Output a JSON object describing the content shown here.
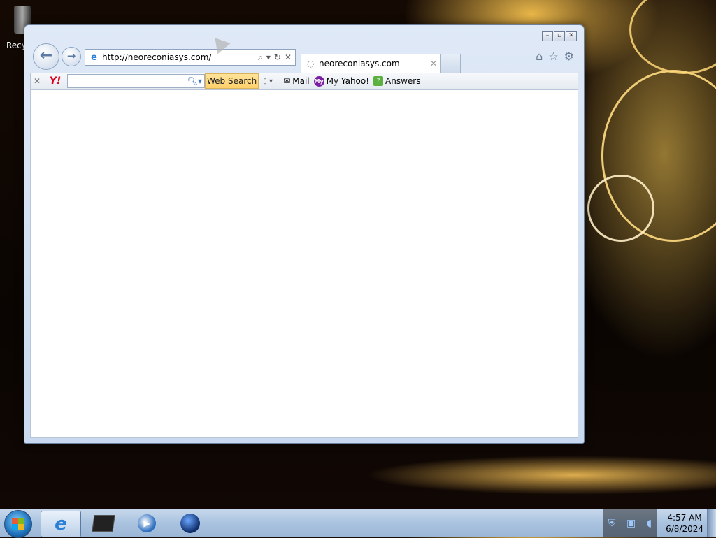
{
  "desktop": {
    "recycle_label": "Recy"
  },
  "browser": {
    "address_url": "http://neoreconiasys.com/",
    "tab_title": "neoreconiasys.com",
    "window_controls": [
      "minimize-icon",
      "restore-icon",
      "close-icon"
    ],
    "nav_icons": [
      "back-arrow-icon",
      "forward-arrow-icon"
    ],
    "right_icons": [
      "home-icon",
      "favorites-star-icon",
      "settings-gear-icon"
    ]
  },
  "yahoo_toolbar": {
    "logo": "Y!",
    "search_placeholder": "",
    "search_button": "Web Search",
    "items": [
      {
        "label": "Mail",
        "icon": "mail-icon"
      },
      {
        "label": "My Yahoo!",
        "icon": "my-yahoo-icon"
      },
      {
        "label": "Answers",
        "icon": "answers-icon"
      }
    ]
  },
  "taskbar": {
    "apps": [
      "internet-explorer-icon",
      "folder-icon",
      "media-player-icon",
      "globe-icon"
    ],
    "tray_icons": [
      "shield-icon",
      "network-icon",
      "volume-icon"
    ],
    "time": "4:57 AM",
    "date": "6/8/2024"
  },
  "colors": {
    "window_frame": "#dfe9f7",
    "taskbar": "#a9c2df",
    "websearch_button": "#ffd06a",
    "yahoo_red": "#e0001b"
  }
}
